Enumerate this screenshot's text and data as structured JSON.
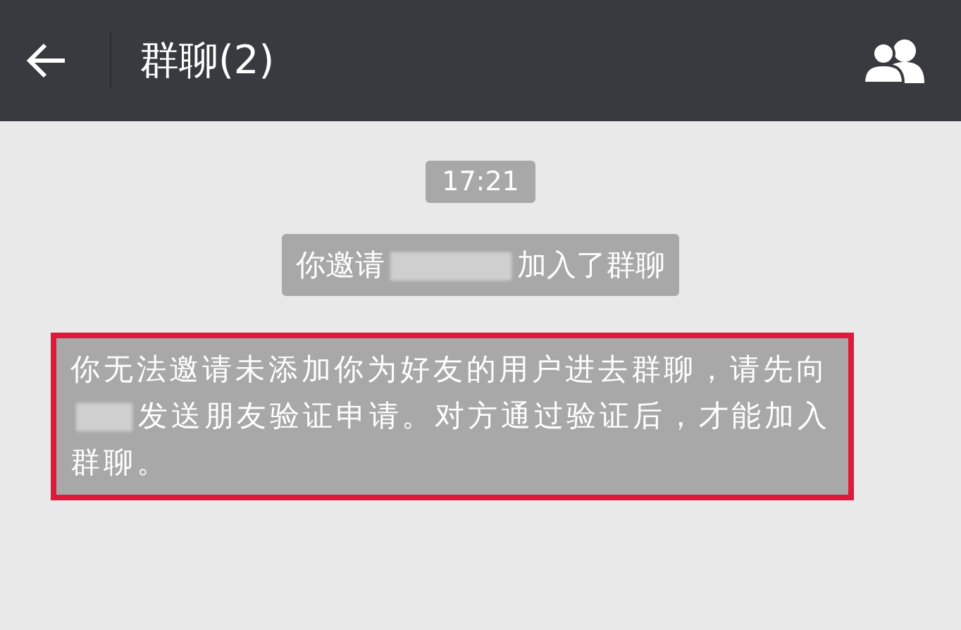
{
  "header": {
    "title": "群聊(2)"
  },
  "messages": [
    {
      "kind": "time",
      "text": "17:21"
    },
    {
      "kind": "system",
      "text_before": "你邀请",
      "redacted": true,
      "text_after": "加入了群聊"
    },
    {
      "kind": "notice",
      "highlighted": true,
      "text_before": "你无法邀请未添加你为好友的用户进去群聊，请先向",
      "redacted": true,
      "text_after": "发送朋友验证申请。对方通过验证后，才能加入群聊。"
    }
  ]
}
